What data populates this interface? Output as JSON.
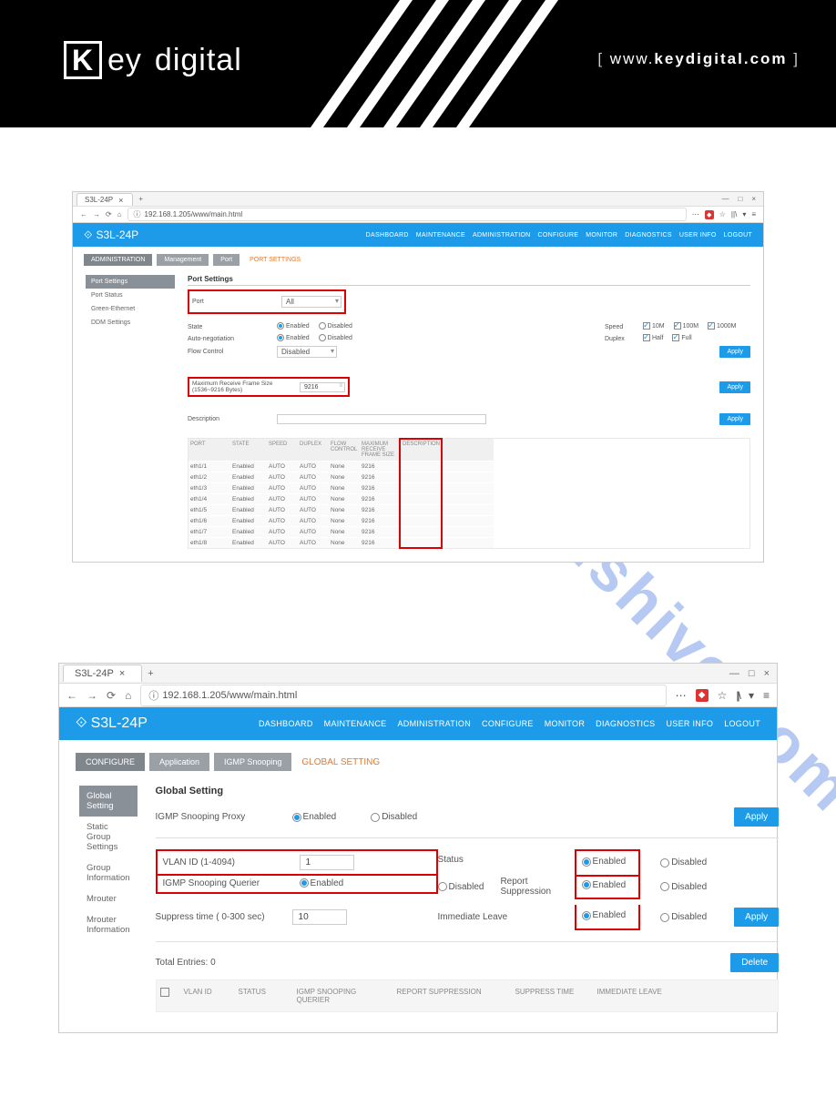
{
  "doc_header": {
    "brand_k": "K",
    "brand_ey": "ey",
    "brand_digital": "digital",
    "url_prefix": "www.",
    "url_domain": "keydigital.com"
  },
  "watermark": "manualshive.com",
  "shot1": {
    "tab_title": "S3L-24P",
    "url": "192.168.1.205/www/main.html",
    "app_name": "S3L-24P",
    "top_nav": [
      "DASHBOARD",
      "MAINTENANCE",
      "ADMINISTRATION",
      "CONFIGURE",
      "MONITOR",
      "DIAGNOSTICS",
      "USER INFO",
      "LOGOUT"
    ],
    "breadcrumb": [
      "ADMINISTRATION",
      "Management",
      "Port"
    ],
    "breadcrumb_current": "PORT SETTINGS",
    "sidebar": [
      "Port Settings",
      "Port Status",
      "Green-Ethernet",
      "DDM Settings"
    ],
    "section_title": "Port Settings",
    "port_label": "Port",
    "port_value": "All",
    "state_label": "State",
    "autoneg_label": "Auto-negotiation",
    "flow_label": "Flow Control",
    "flow_value": "Disabled",
    "enabled": "Enabled",
    "disabled": "Disabled",
    "speed_label": "Speed",
    "speed_options": [
      "10M",
      "100M",
      "1000M"
    ],
    "duplex_label": "Duplex",
    "duplex_options": [
      "Half",
      "Full"
    ],
    "apply": "Apply",
    "mrfs_label": "Maximum Receive Frame Size (1536~9216 Bytes)",
    "mrfs_value": "9216",
    "desc_label": "Description",
    "table_headers": [
      "PORT",
      "STATE",
      "SPEED",
      "DUPLEX",
      "FLOW CONTROL",
      "MAXIMUM RECEIVE FRAME SIZE",
      "DESCRIPTION"
    ],
    "ports": [
      {
        "p": "eth1/1",
        "st": "Enabled",
        "sp": "AUTO",
        "du": "AUTO",
        "fc": "None",
        "m": "9216"
      },
      {
        "p": "eth1/2",
        "st": "Enabled",
        "sp": "AUTO",
        "du": "AUTO",
        "fc": "None",
        "m": "9216"
      },
      {
        "p": "eth1/3",
        "st": "Enabled",
        "sp": "AUTO",
        "du": "AUTO",
        "fc": "None",
        "m": "9216"
      },
      {
        "p": "eth1/4",
        "st": "Enabled",
        "sp": "AUTO",
        "du": "AUTO",
        "fc": "None",
        "m": "9216"
      },
      {
        "p": "eth1/5",
        "st": "Enabled",
        "sp": "AUTO",
        "du": "AUTO",
        "fc": "None",
        "m": "9216"
      },
      {
        "p": "eth1/6",
        "st": "Enabled",
        "sp": "AUTO",
        "du": "AUTO",
        "fc": "None",
        "m": "9216"
      },
      {
        "p": "eth1/7",
        "st": "Enabled",
        "sp": "AUTO",
        "du": "AUTO",
        "fc": "None",
        "m": "9216"
      },
      {
        "p": "eth1/8",
        "st": "Enabled",
        "sp": "AUTO",
        "du": "AUTO",
        "fc": "None",
        "m": "9216"
      }
    ]
  },
  "shot2": {
    "tab_title": "S3L-24P",
    "url": "192.168.1.205/www/main.html",
    "app_name": "S3L-24P",
    "top_nav": [
      "DASHBOARD",
      "MAINTENANCE",
      "ADMINISTRATION",
      "CONFIGURE",
      "MONITOR",
      "DIAGNOSTICS",
      "USER INFO",
      "LOGOUT"
    ],
    "breadcrumb": [
      "CONFIGURE",
      "Application",
      "IGMP Snooping"
    ],
    "breadcrumb_current": "GLOBAL SETTING",
    "sidebar": [
      "Global Setting",
      "Static Group Settings",
      "Group Information",
      "Mrouter",
      "Mrouter Information"
    ],
    "section_title": "Global Setting",
    "proxy_label": "IGMP Snooping Proxy",
    "enabled": "Enabled",
    "disabled": "Disabled",
    "apply": "Apply",
    "vlan_label": "VLAN ID (1-4094)",
    "vlan_value": "1",
    "querier_label": "IGMP Snooping Querier",
    "suppress_label": "Suppress time ( 0-300 sec)",
    "suppress_value": "10",
    "status_label": "Status",
    "report_label": "Report Suppression",
    "leave_label": "Immediate Leave",
    "total_entries": "Total Entries: 0",
    "delete": "Delete",
    "table_headers": [
      "VLAN ID",
      "STATUS",
      "IGMP SNOOPING QUERIER",
      "REPORT SUPPRESSION",
      "SUPPRESS TIME",
      "IMMEDIATE LEAVE"
    ]
  }
}
